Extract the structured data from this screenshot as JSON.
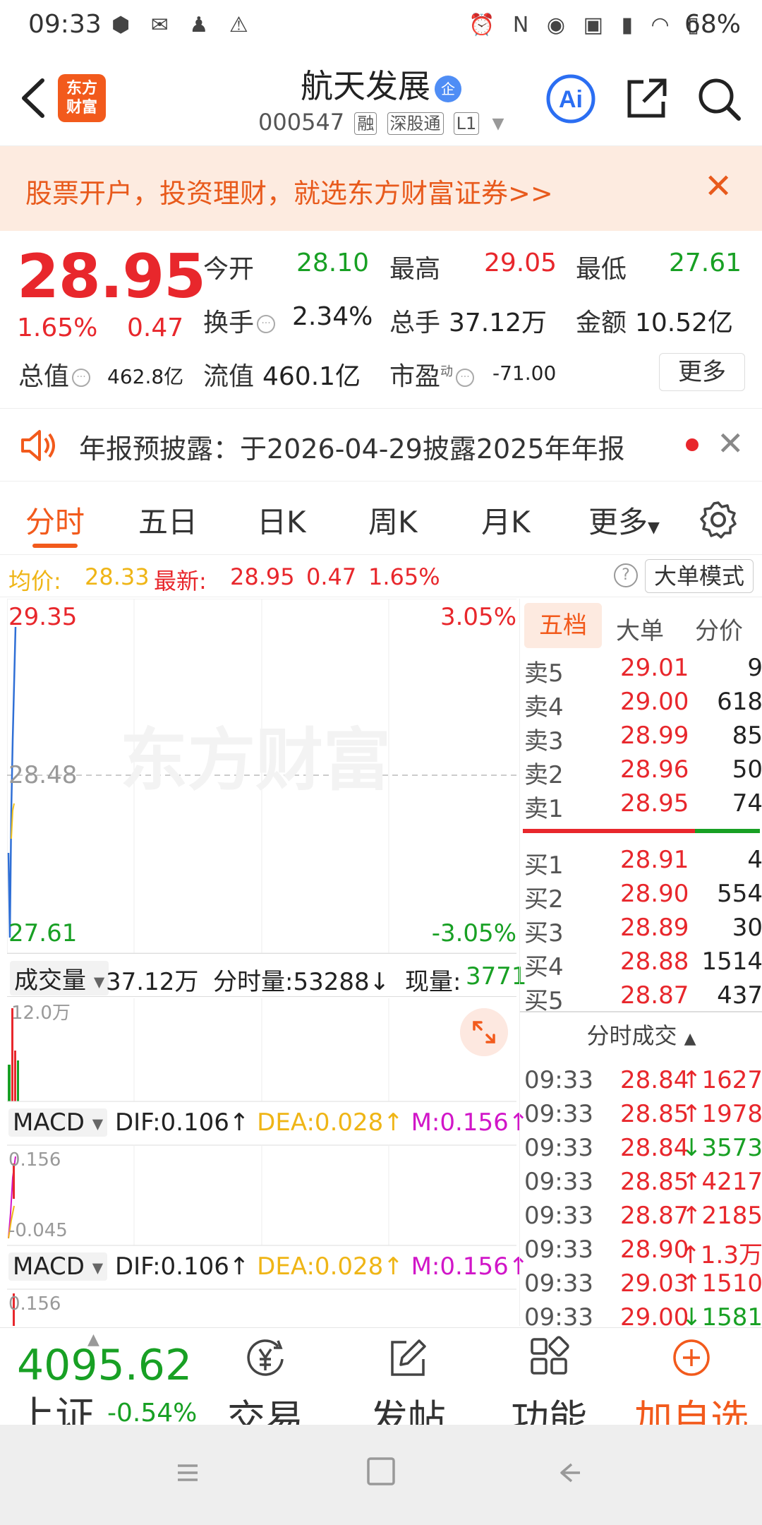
{
  "status_bar": {
    "time": "09:33",
    "battery": "68%"
  },
  "header": {
    "logo_line1": "东方",
    "logo_line2": "财富",
    "stock_name": "航天发展",
    "qi_badge": "企",
    "stock_code": "000547",
    "tag_rong": "融",
    "tag_sgt": "深股通",
    "tag_level": "L1",
    "ai_label": "Ai"
  },
  "promo": {
    "text": "股票开户，投资理财，就选东方财富证券>>"
  },
  "quote": {
    "price": "28.95",
    "pct_change": "1.65%",
    "abs_change": "0.47",
    "open_label": "今开",
    "open": "28.10",
    "high_label": "最高",
    "high": "29.05",
    "low_label": "最低",
    "low": "27.61",
    "turnover_label": "换手",
    "turnover": "2.34%",
    "volume_label": "总手",
    "volume": "37.12万",
    "amount_label": "金额",
    "amount": "10.52亿",
    "mktcap_label": "总值",
    "mktcap": "462.8亿",
    "float_label": "流值",
    "float_cap": "460.1亿",
    "pe_label": "市盈",
    "pe_sup": "动",
    "pe": "-71.00",
    "more_label": "更多"
  },
  "notice": {
    "text": "年报预披露：于2026-04-29披露2025年年报"
  },
  "tabs": [
    "分时",
    "五日",
    "日K",
    "周K",
    "月K",
    "更多"
  ],
  "avg_row": {
    "avg_label": "均价:",
    "avg_value": "28.33",
    "latest_label": "最新:",
    "latest_value": "28.95",
    "latest_change": "0.47",
    "latest_pct": "1.65%",
    "help": "?",
    "mode_label": "大单模式"
  },
  "chart": {
    "price_top": "29.35",
    "price_mid": "28.48",
    "price_bottom": "27.61",
    "pct_top": "3.05%",
    "pct_bottom": "-3.05%",
    "watermark": "东方财富",
    "vol_dropdown": "成交量",
    "vol_total": "37.12万",
    "vol_fenshi": "分时量:53288↓",
    "vol_now_label": "现量:",
    "vol_now_value": "3771",
    "vol_axis_top": "12.0万",
    "macd1_dropdown": "MACD",
    "macd1_dif": "DIF:0.106↑",
    "macd1_dea": "DEA:0.028↑",
    "macd1_m": "M:0.156↑",
    "macd1_axis_top": "0.156",
    "macd1_axis_bottom": "-0.045",
    "macd2_dropdown": "MACD",
    "macd2_dif": "DIF:0.106↑",
    "macd2_dea": "DEA:0.028↑",
    "macd2_m": "M:0.156↑",
    "macd2_axis_top": "0.156"
  },
  "right_panel": {
    "tabs": [
      "五档",
      "大单",
      "分价"
    ],
    "asks": [
      {
        "label": "卖5",
        "price": "29.01",
        "vol": "9"
      },
      {
        "label": "卖4",
        "price": "29.00",
        "vol": "618"
      },
      {
        "label": "卖3",
        "price": "28.99",
        "vol": "85"
      },
      {
        "label": "卖2",
        "price": "28.96",
        "vol": "50"
      },
      {
        "label": "卖1",
        "price": "28.95",
        "vol": "74"
      }
    ],
    "bids": [
      {
        "label": "买1",
        "price": "28.91",
        "vol": "4"
      },
      {
        "label": "买2",
        "price": "28.90",
        "vol": "554"
      },
      {
        "label": "买3",
        "price": "28.89",
        "vol": "30"
      },
      {
        "label": "买4",
        "price": "28.88",
        "vol": "1514"
      },
      {
        "label": "买5",
        "price": "28.87",
        "vol": "437"
      }
    ],
    "trades_header": "分时成交",
    "trades": [
      {
        "time": "09:33",
        "price": "28.84",
        "vol": "↑1627",
        "dir": "up"
      },
      {
        "time": "09:33",
        "price": "28.85",
        "vol": "↑1978",
        "dir": "up"
      },
      {
        "time": "09:33",
        "price": "28.84",
        "vol": "↓3573",
        "dir": "down"
      },
      {
        "time": "09:33",
        "price": "28.85",
        "vol": "↑4217",
        "dir": "up"
      },
      {
        "time": "09:33",
        "price": "28.87",
        "vol": "↑2185",
        "dir": "up"
      },
      {
        "time": "09:33",
        "price": "28.90",
        "vol": "↑1.3万",
        "dir": "up"
      },
      {
        "time": "09:33",
        "price": "29.03",
        "vol": "↑1510",
        "dir": "up"
      },
      {
        "time": "09:33",
        "price": "29.00",
        "vol": "↓1581",
        "dir": "down"
      }
    ]
  },
  "bottom_nav": {
    "index_value": "4095.62",
    "index_name": "上证",
    "index_change": "-0.54%",
    "items": [
      {
        "label": "交易",
        "icon": "yen-circle-icon"
      },
      {
        "label": "发帖",
        "icon": "edit-icon"
      },
      {
        "label": "功能",
        "icon": "grid-icon"
      },
      {
        "label": "加自选",
        "icon": "plus-circle-icon"
      }
    ]
  },
  "colors": {
    "accent": "#f25a1c",
    "up": "#e8272c",
    "down": "#18a024"
  }
}
